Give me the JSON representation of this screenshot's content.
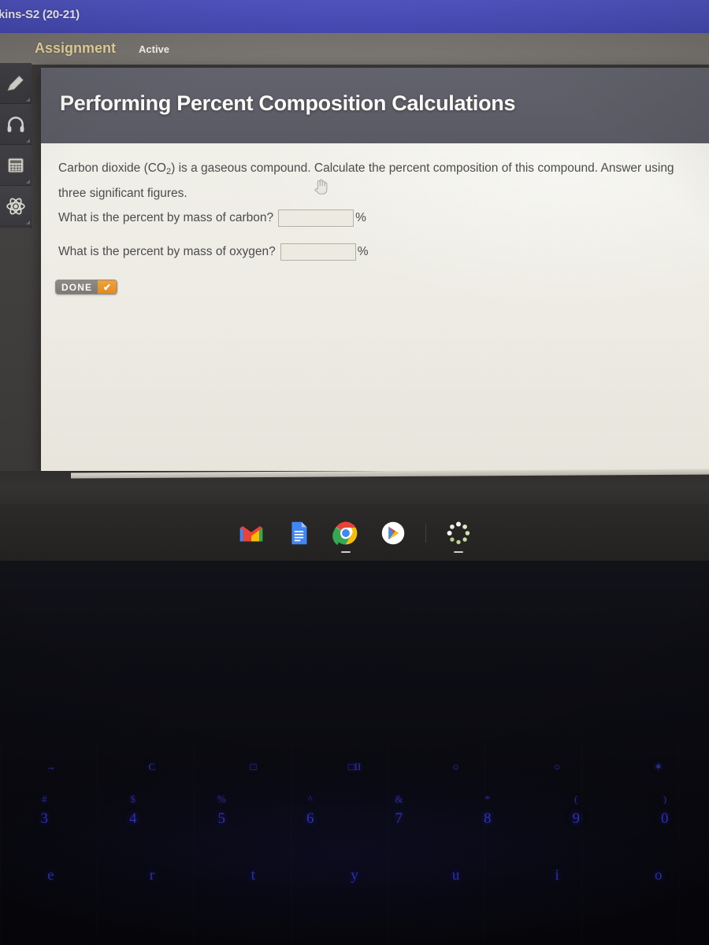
{
  "appbar": {
    "title": "kins-S2 (20-21)",
    "color": "#4a4eb8"
  },
  "toolbar": {
    "assignment_label": "Assignment",
    "assignment_color": "#e7d49a",
    "status_label": "Active"
  },
  "rail": {
    "items": [
      {
        "name": "pencil-icon",
        "label": "Pencil"
      },
      {
        "name": "headphones-icon",
        "label": "Headphones"
      },
      {
        "name": "calculator-icon",
        "label": "Calculator"
      },
      {
        "name": "atom-icon",
        "label": "Periodic Table"
      }
    ]
  },
  "card": {
    "title": "Performing Percent Composition Calculations",
    "header_color": "#5e5e68",
    "body_color": "#efeee6",
    "prompt_lead": "Carbon dioxide (CO",
    "prompt_sub": "2",
    "prompt_rest": ") is a gaseous compound. Calculate the percent composition of this compound. Answer using three significant figures.",
    "questions": [
      {
        "label": "What is the percent by mass of carbon?",
        "value": "",
        "placeholder": "",
        "unit": "%"
      },
      {
        "label": "What is the percent by mass of oxygen?",
        "value": "",
        "placeholder": "",
        "unit": "%"
      }
    ],
    "done_label": "DONE",
    "done_check": "✔",
    "done_accent": "#e08a22"
  },
  "shelf": {
    "items": [
      {
        "name": "gmail-icon",
        "label": "Gmail",
        "running": false
      },
      {
        "name": "google-docs-icon",
        "label": "Docs",
        "running": false
      },
      {
        "name": "chrome-icon",
        "label": "Chrome",
        "running": true
      },
      {
        "name": "play-store-icon",
        "label": "Play Store",
        "running": false
      },
      {
        "name": "loading-spinner-icon",
        "label": "Loading",
        "running": true
      }
    ]
  },
  "keyboard": {
    "function_row": [
      "→",
      "C",
      "□",
      "□II",
      "○",
      "○",
      "✶"
    ],
    "number_row": [
      {
        "sup": "#",
        "main": "3"
      },
      {
        "sup": "$",
        "main": "4"
      },
      {
        "sup": "%",
        "main": "5"
      },
      {
        "sup": "^",
        "main": "6"
      },
      {
        "sup": "&",
        "main": "7"
      },
      {
        "sup": "*",
        "main": "8"
      },
      {
        "sup": "(",
        "main": "9"
      },
      {
        "sup": ")",
        "main": "0"
      }
    ],
    "letter_row": [
      "e",
      "r",
      "t",
      "y",
      "u",
      "i",
      "o"
    ],
    "backlight_color": "#3b3be0"
  }
}
